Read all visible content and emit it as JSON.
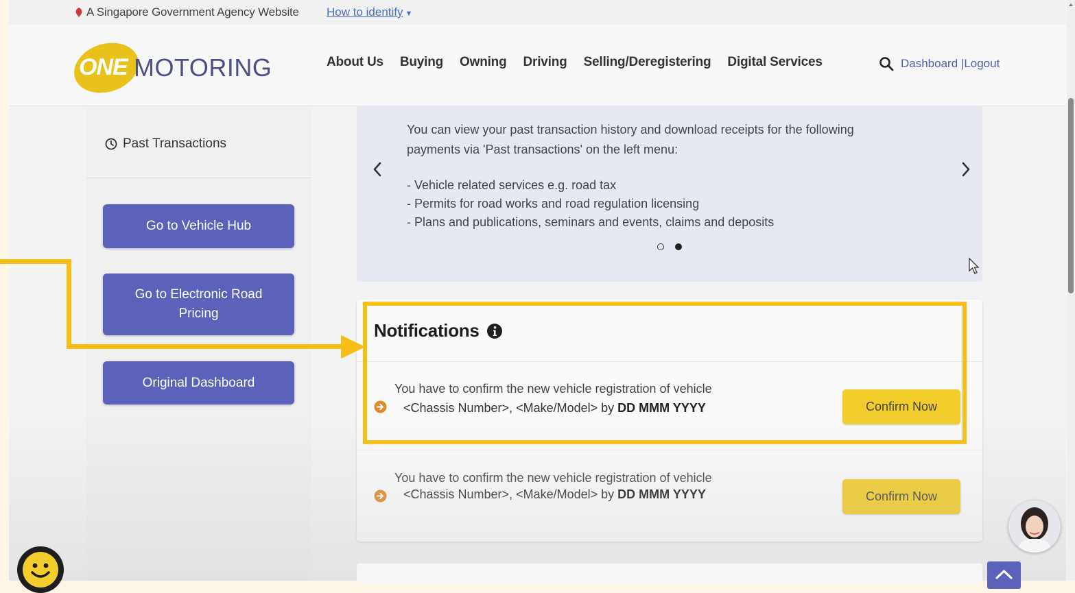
{
  "govbar": {
    "text": "A Singapore Government Agency Website",
    "how_to_identify": "How to identify"
  },
  "header": {
    "logo_one": "ONE",
    "logo_motoring": "MOTORING",
    "nav": [
      "About Us",
      "Buying",
      "Owning",
      "Driving",
      "Selling/Deregistering",
      "Digital Services"
    ],
    "dashboard_link": "Dashboard |",
    "logout_link": "Logout"
  },
  "sidebar": {
    "past_transactions": "Past Transactions",
    "buttons": {
      "vehicle_hub": "Go to Vehicle Hub",
      "erp": "Go to Electronic Road Pricing",
      "original_dashboard": "Original Dashboard"
    }
  },
  "carousel": {
    "text": "You can view your past transaction history and download receipts for the following payments via 'Past transactions' on the left menu:",
    "bullets": [
      "- Vehicle related services e.g. road tax",
      "- Permits for road works and road regulation licensing",
      "- Plans and publications, seminars and events, claims and deposits"
    ],
    "active_slide": 2,
    "slide_count": 2
  },
  "notifications": {
    "title": "Notifications",
    "items": [
      {
        "line1": "You have to confirm the new vehicle registration of vehicle",
        "line2_prefix": "<Chassis Number>, <Make/Model> by ",
        "line2_date": "DD MMM YYYY",
        "button": "Confirm Now"
      },
      {
        "line1": "You have to confirm the new vehicle registration of vehicle",
        "line2_prefix": "<Chassis Number>, <Make/Model> by ",
        "line2_date": "DD MMM YYYY",
        "button": "Confirm Now"
      }
    ]
  },
  "colors": {
    "brand_purple": "#5c62ba",
    "highlight_yellow": "#f7bf16",
    "button_yellow": "#f2cd2c",
    "logo_yellow": "#e8c21a",
    "link_blue": "#4f5fa8"
  },
  "icons": {
    "lion": "lion-icon",
    "search": "search-icon",
    "clock": "clock-icon",
    "info": "info-icon",
    "bullet": "arrow-circle-icon",
    "smiley": "smiley-icon",
    "avatar": "assistant-avatar-icon",
    "to_top": "chevron-up-icon"
  }
}
